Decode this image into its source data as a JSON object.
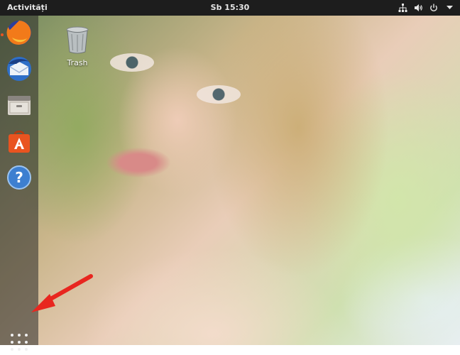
{
  "topbar": {
    "activities_label": "Activități",
    "clock": "Sb 15:30",
    "tray_icons": [
      "network-icon",
      "volume-icon",
      "power-icon",
      "menu-arrow-icon"
    ]
  },
  "dock": {
    "items": [
      {
        "name": "firefox",
        "icon": "firefox-icon",
        "running": true
      },
      {
        "name": "thunderbird",
        "icon": "thunderbird-icon",
        "running": false
      },
      {
        "name": "files",
        "icon": "files-icon",
        "running": false
      },
      {
        "name": "software",
        "icon": "software-center-icon",
        "running": false
      },
      {
        "name": "help",
        "icon": "help-icon",
        "running": false
      }
    ],
    "show_apps_icon": "apps-grid-icon"
  },
  "desktop": {
    "icons": [
      {
        "label": "Trash",
        "icon": "trash-icon"
      }
    ]
  },
  "colors": {
    "topbar": "#1d1d1d",
    "accent": "#e95420",
    "annotation_arrow": "#e8261f"
  },
  "help_glyph": "?"
}
